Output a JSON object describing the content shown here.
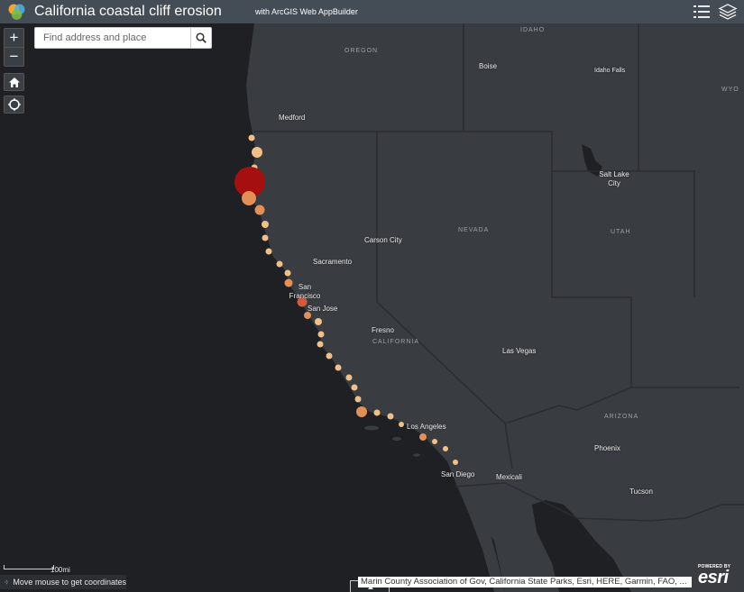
{
  "header": {
    "title": "California coastal cliff erosion",
    "subtitle": "with ArcGIS Web AppBuilder"
  },
  "search": {
    "placeholder": "Find address and place"
  },
  "zoom": {
    "in": "+",
    "out": "−"
  },
  "map": {
    "places": [
      {
        "name": "Medford"
      },
      {
        "name": "Boise"
      },
      {
        "name": "Idaho Falls"
      },
      {
        "name": "Salt Lake City"
      },
      {
        "name": "Carson City"
      },
      {
        "name": "Sacramento"
      },
      {
        "name": "San Francisco"
      },
      {
        "name": "San Jose"
      },
      {
        "name": "Fresno"
      },
      {
        "name": "Las Vegas"
      },
      {
        "name": "Los Angeles"
      },
      {
        "name": "Phoenix"
      },
      {
        "name": "San Diego"
      },
      {
        "name": "Mexicali"
      },
      {
        "name": "Tucson"
      }
    ],
    "regions": [
      "IDAHO",
      "OREGON",
      "WYO",
      "NEVADA",
      "UTAH",
      "CALIFORNIA",
      "ARIZONA"
    ],
    "colors": {
      "land": "#393d42",
      "water": "#1e2023",
      "border": "#2a2d31",
      "symbol_small": "#f1c088",
      "symbol_medium": "#e38f55",
      "symbol_large": "#d25a3e",
      "symbol_max": "#a50f0f"
    }
  },
  "scale": {
    "label": "100mi"
  },
  "coordinates": {
    "text": "Move mouse to get coordinates"
  },
  "attribution": {
    "text": "Marin County Association of Gov, California State Parks, Esri, HERE, Garmin, FAO, ..."
  },
  "logo": {
    "powered": "POWERED BY",
    "word": "esri"
  }
}
